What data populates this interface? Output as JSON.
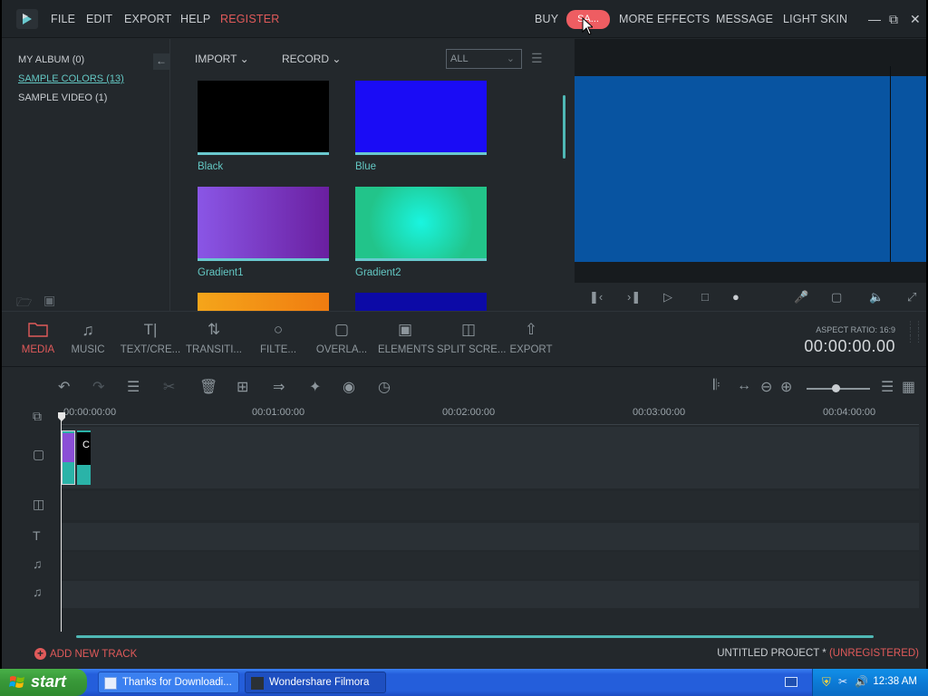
{
  "menubar": {
    "items": [
      "FILE",
      "EDIT",
      "EXPORT",
      "HELP"
    ],
    "register": "REGISTER",
    "right_items": [
      "BUY",
      "MORE EFFECTS",
      "MESSAGE",
      "LIGHT SKIN"
    ],
    "sale": "SA...",
    "window_controls": [
      "minimize-icon",
      "restore-icon",
      "close-icon"
    ]
  },
  "album": {
    "items": [
      "MY ALBUM (0)",
      "SAMPLE COLORS (13)",
      "SAMPLE VIDEO (1)"
    ],
    "active_index": 1
  },
  "library": {
    "import_label": "IMPORT",
    "record_label": "RECORD",
    "filter_value": "ALL",
    "thumbs": [
      {
        "label": "Black",
        "color": "#000000"
      },
      {
        "label": "Blue",
        "color": "#1a0cf5"
      },
      {
        "label": "Gradient1",
        "color": "#8a3fd6"
      },
      {
        "label": "Gradient2",
        "color": "#21d6b0"
      },
      {
        "label": "",
        "color": "#f39a1a"
      },
      {
        "label": "",
        "color": "#0c0aa6"
      }
    ]
  },
  "preview": {
    "screen_color": "#0854a1"
  },
  "toolbar": {
    "tools": [
      "MEDIA",
      "MUSIC",
      "TEXT/CRE...",
      "TRANSITI...",
      "FILTE...",
      "OVERLA...",
      "ELEMENTS",
      "SPLIT SCRE...",
      "EXPORT"
    ],
    "active_tool": "MEDIA",
    "aspect_ratio": "ASPECT RATIO: 16:9",
    "timecode": "00:00:00.00"
  },
  "timeline": {
    "ruler_ticks": [
      "00:00:00:00",
      "00:01:00:00",
      "00:02:00:00",
      "00:03:00:00",
      "00:04:00:00"
    ],
    "clip_letter": "C",
    "add_track": "ADD NEW TRACK",
    "project_name": "UNTITLED PROJECT *",
    "project_status": "(UNREGISTERED)"
  },
  "taskbar": {
    "start": "start",
    "tasks": [
      "Thanks for Downloadi...",
      "Wondershare Filmora"
    ],
    "clock": "12:38 AM"
  },
  "colors": {
    "accent_red": "#e05a5a",
    "accent_teal": "#63c7c3",
    "panel_bg": "#23282c"
  }
}
